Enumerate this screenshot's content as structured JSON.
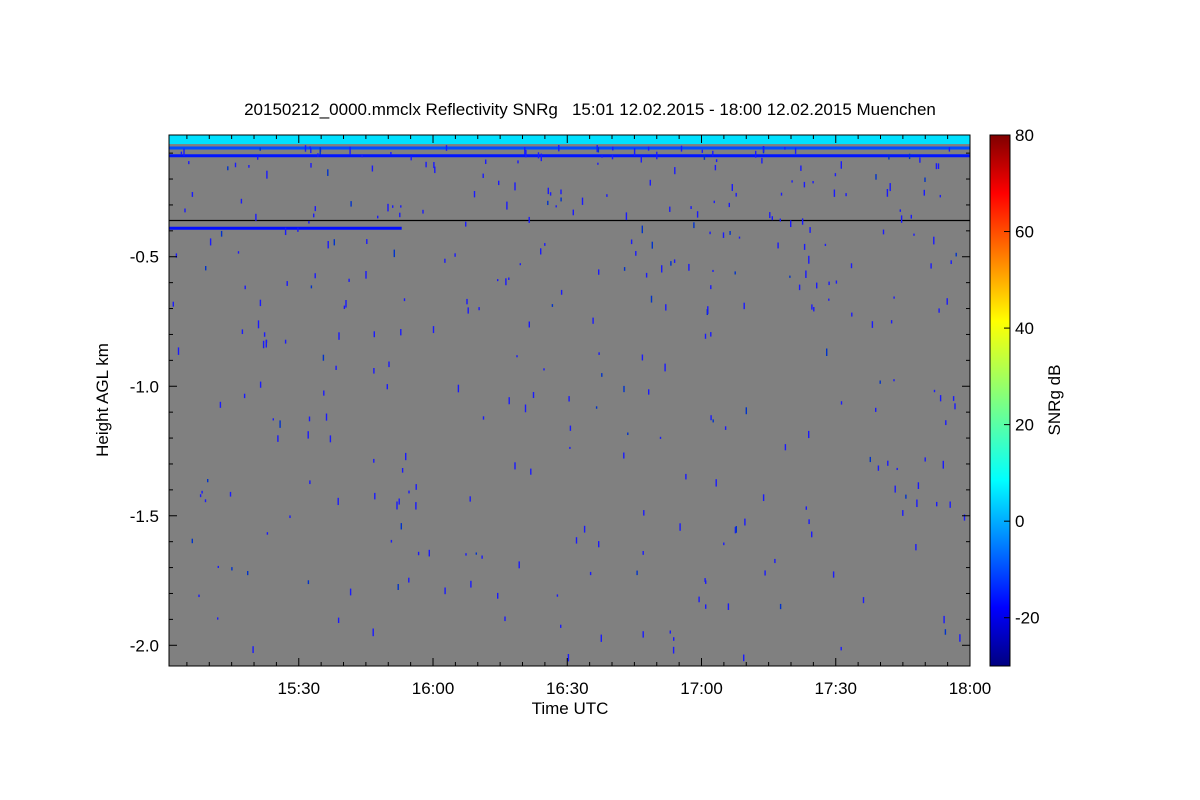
{
  "chart_data": {
    "type": "heatmap",
    "title": "20150212_0000.mmclx Reflectivity SNRg   15:01 12.02.2015 - 18:00 12.02.2015 Muenchen",
    "xlabel": "Time UTC",
    "ylabel": "Height AGL km",
    "x_range": [
      "15:01",
      "18:00"
    ],
    "x_ticks": [
      "15:30",
      "16:00",
      "16:30",
      "17:00",
      "17:30",
      "18:00"
    ],
    "y_range": [
      -2.08,
      -0.03
    ],
    "y_ticks": [
      -0.5,
      -1.0,
      -1.5,
      -2.0
    ],
    "y_tick_labels": [
      "-0.5",
      "-1.0",
      "-1.5",
      "-2.0"
    ],
    "background_color": "#808080",
    "colorbar": {
      "label": "SNRg dB",
      "range": [
        -30,
        80
      ],
      "ticks": [
        -20,
        0,
        20,
        40,
        60,
        80
      ],
      "tick_labels": [
        "-20",
        "0",
        "20",
        "40",
        "60",
        "80"
      ],
      "colormap": "jet"
    },
    "features": [
      {
        "kind": "band",
        "t_start": "15:01",
        "t_end": "18:00",
        "h_top": -0.03,
        "h_bottom": -0.065,
        "snr": 8
      },
      {
        "kind": "line",
        "t_start": "15:01",
        "t_end": "18:00",
        "h": -0.08,
        "snr": -8
      },
      {
        "kind": "line",
        "t_start": "15:01",
        "t_end": "18:00",
        "h": -0.11,
        "snr": -14
      },
      {
        "kind": "black-line",
        "t_start": "15:01",
        "t_end": "18:00",
        "h": -0.36
      },
      {
        "kind": "line",
        "t_start": "15:01",
        "t_end": "15:53",
        "h": -0.39,
        "snr": -15
      }
    ]
  }
}
